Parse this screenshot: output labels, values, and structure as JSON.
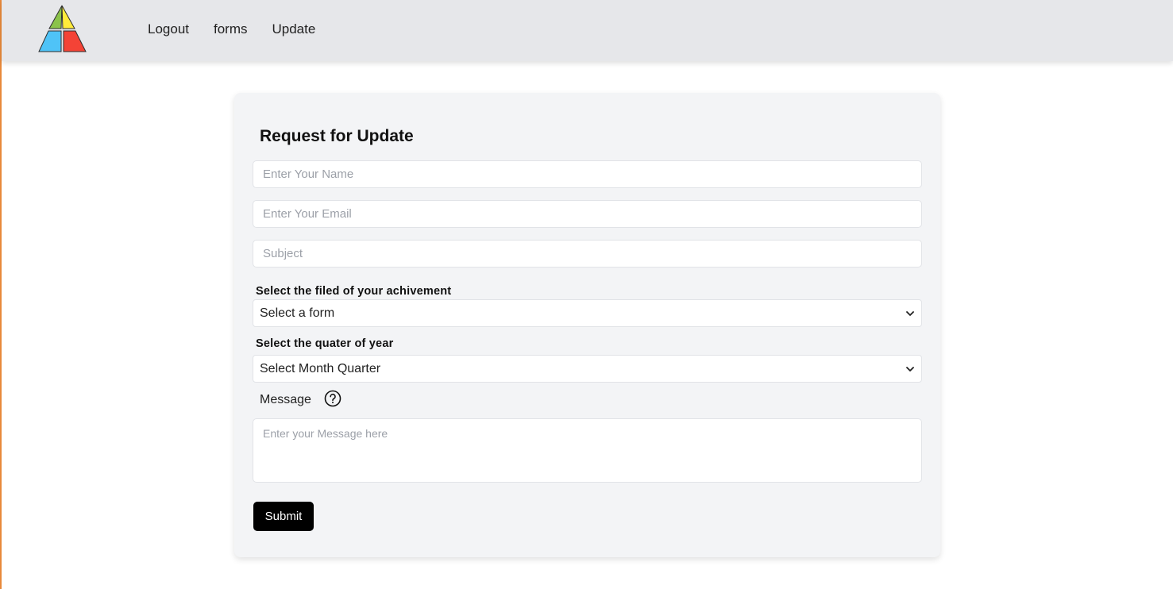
{
  "nav": {
    "links": [
      "Logout",
      "forms",
      "Update"
    ]
  },
  "form": {
    "title": "Request for Update",
    "name_placeholder": "Enter Your Name",
    "email_placeholder": "Enter Your Email",
    "subject_placeholder": "Subject",
    "field_label": "Select the filed of your achivement",
    "field_selected": "Select a form",
    "quarter_label": "Select the quater of year",
    "quarter_selected": "Select Month Quarter",
    "message_label": "Message",
    "message_placeholder": "Enter your Message here",
    "submit_label": "Submit"
  },
  "colors": {
    "logo_green": "#8bc34a",
    "logo_yellow": "#ffeb3b",
    "logo_blue": "#4fc3f7",
    "logo_red": "#f44336",
    "accent_border": "#e8893a"
  },
  "icons": {
    "help": "question-circle-icon",
    "select_arrow": "chevron-down-icon"
  }
}
